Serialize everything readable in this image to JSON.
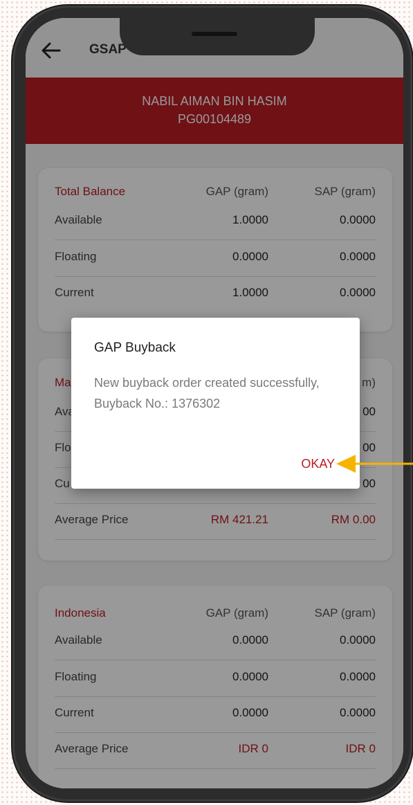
{
  "appbar": {
    "title": "GSAP",
    "back_icon": "arrow-left-icon"
  },
  "banner": {
    "name": "NABIL AIMAN BIN HASIM",
    "account_id": "PG00104489"
  },
  "total_balance": {
    "header": [
      "Total Balance",
      "GAP (gram)",
      "SAP (gram)"
    ],
    "rows": [
      [
        "Available",
        "1.0000",
        "0.0000"
      ],
      [
        "Floating",
        "0.0000",
        "0.0000"
      ],
      [
        "Current",
        "1.0000",
        "0.0000"
      ]
    ]
  },
  "malaysia": {
    "header": [
      "Ma",
      "",
      "m)"
    ],
    "rows": [
      [
        "Ava",
        "",
        "00"
      ],
      [
        "Flo",
        "",
        "00"
      ],
      [
        "Cu",
        "",
        "00"
      ],
      [
        "Average Price",
        "RM 421.21",
        "RM 0.00"
      ]
    ]
  },
  "indonesia": {
    "header": [
      "Indonesia",
      "GAP (gram)",
      "SAP (gram)"
    ],
    "rows": [
      [
        "Available",
        "0.0000",
        "0.0000"
      ],
      [
        "Floating",
        "0.0000",
        "0.0000"
      ],
      [
        "Current",
        "0.0000",
        "0.0000"
      ],
      [
        "Average Price",
        "IDR 0",
        "IDR 0"
      ]
    ]
  },
  "dialog": {
    "title": "GAP Buyback",
    "message": "New buyback order created successfully, Buyback No.: 1376302",
    "okay_label": "OKAY"
  },
  "colors": {
    "brand_red": "#b91d24",
    "annotation_arrow": "#f5b400"
  }
}
